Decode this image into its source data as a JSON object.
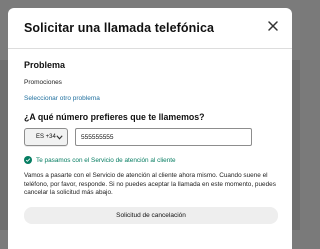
{
  "modal": {
    "title": "Solicitar una llamada telefónica",
    "close_icon": "close-icon"
  },
  "problem": {
    "heading": "Problema",
    "value": "Promociones",
    "change_link": "Seleccionar otro problema"
  },
  "phone": {
    "question": "¿A qué número prefieres que te llamemos?",
    "country_code": "ES +34",
    "number": "555555555"
  },
  "status": {
    "icon": "check-circle-icon",
    "text": "Te pasamos con el Servicio de atención al cliente",
    "color": "#067d62"
  },
  "info_text": "Vamos a pasarte con el Servicio de atención al cliente ahora mismo. Cuando suene el teléfono, por favor, responde. Si no puedes aceptar la llamada en este momento, puedes cancelar la solicitud más abajo.",
  "cancel_button": "Solicitud de cancelación",
  "colors": {
    "link": "#1f6f9e",
    "overlay": "#7b7b7b"
  }
}
